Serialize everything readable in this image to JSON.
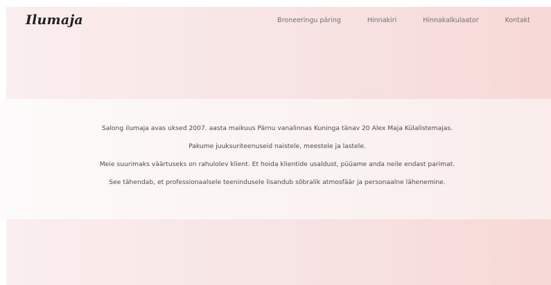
{
  "header": {
    "logo": "Ilumaja",
    "nav": [
      {
        "label": "Broneeringu päring"
      },
      {
        "label": "Hinnakiri"
      },
      {
        "label": "Hinnakalkulaator"
      },
      {
        "label": "Kontakt"
      }
    ]
  },
  "intro": {
    "lines": [
      "Salong ilumaja avas uksed 2007. aasta maikuus Pärnu vanalinnas Kuninga tänav 20 Alex Maja Külalistemajas.",
      "Pakume juuksuriteenuseid naistele, meestele ja lastele.",
      "Meie suurimaks väärtuseks on rahulolev klient. Et hoida klientide usaldust, püüame anda neile endast parimat.",
      "See tähendab, et professionaalsele teenindusele lisandub sõbralik atmosfäär ja personaalne lähenemine."
    ]
  },
  "colors": {
    "band_light": "#fbeeee",
    "band_dark": "#f7d9d7",
    "text": "#4a4a4a",
    "nav_text": "#707070",
    "logo": "#222222"
  }
}
